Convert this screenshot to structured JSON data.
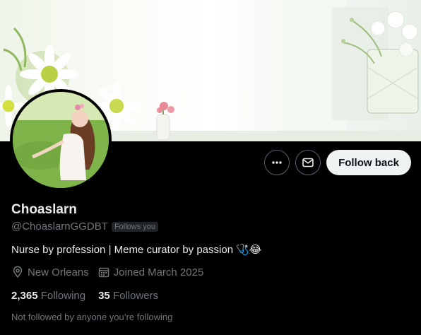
{
  "profile": {
    "display_name": "Choaslarn",
    "handle": "@ChoaslarnGGDBT",
    "follows_you_badge": "Follows you",
    "bio_text": "Nurse by profession | Meme curator by passion",
    "bio_emojis": "🩺😂",
    "location": "New Orleans",
    "joined": "Joined March 2025"
  },
  "stats": {
    "following_count": "2,365",
    "following_label": "Following",
    "followers_count": "35",
    "followers_label": "Followers"
  },
  "actions": {
    "follow_back_label": "Follow back",
    "more_icon": "more-icon",
    "message_icon": "envelope-icon"
  },
  "footer_note": "Not followed by anyone you’re following",
  "colors": {
    "background": "#000000",
    "primary_text": "#e7e9ea",
    "secondary_text": "#71767b",
    "button_bg": "#eff3f4",
    "button_text": "#0f1419",
    "border": "#536471"
  }
}
